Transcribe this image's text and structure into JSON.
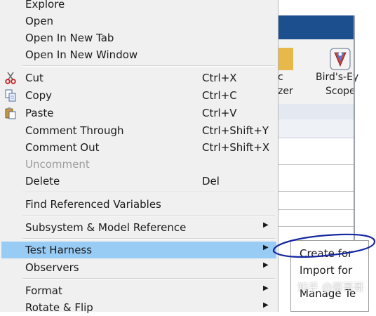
{
  "background_window": {
    "toolbar_partial_label_line1": "c",
    "toolbar_partial_label_line2": "zer",
    "birdseye_label_line1": "Bird's-Ey",
    "birdseye_label_line2": "Scope"
  },
  "context_menu": {
    "items": [
      {
        "label": "Explore"
      },
      {
        "label": "Open"
      },
      {
        "label": "Open In New Tab"
      },
      {
        "label": "Open In New Window"
      },
      {
        "label": "Cut",
        "shortcut": "Ctrl+X",
        "icon": "scissors-icon"
      },
      {
        "label": "Copy",
        "shortcut": "Ctrl+C",
        "icon": "copy-icon"
      },
      {
        "label": "Paste",
        "shortcut": "Ctrl+V",
        "icon": "paste-icon"
      },
      {
        "label": "Comment Through",
        "shortcut": "Ctrl+Shift+Y"
      },
      {
        "label": "Comment Out",
        "shortcut": "Ctrl+Shift+X"
      },
      {
        "label": "Uncomment",
        "disabled": true
      },
      {
        "label": "Delete",
        "shortcut": "Del"
      },
      {
        "label": "Find Referenced Variables"
      },
      {
        "label": "Subsystem & Model Reference",
        "submenu": true
      },
      {
        "label": "Test Harness",
        "submenu": true,
        "highlighted": true
      },
      {
        "label": "Observers",
        "submenu": true
      },
      {
        "label": "Format",
        "submenu": true
      },
      {
        "label": "Rotate & Flip",
        "submenu": true
      }
    ],
    "highlight_color": "#99ccf5"
  },
  "test_harness_submenu": {
    "items": [
      {
        "label": "Create for"
      },
      {
        "label": "Import for"
      },
      {
        "label": "Manage Te"
      }
    ]
  },
  "annotation_color": "#1428a0",
  "watermark": "知乎 @蔡哥哥"
}
